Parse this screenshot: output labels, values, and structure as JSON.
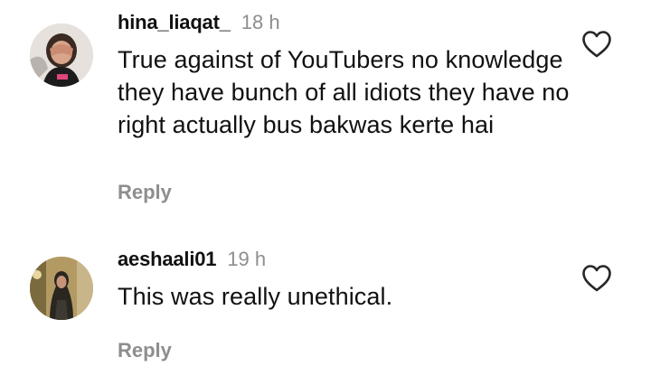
{
  "comments": [
    {
      "username": "hina_liaqat_",
      "time": "18 h",
      "text": "True against of YouTubers no knowledge they have bunch of all idiots they have no right actually bus bakwas kerte hai",
      "reply_label": "Reply",
      "avatar_icon": "avatar-photo",
      "like_icon": "heart-outline-icon"
    },
    {
      "username": "aeshaali01",
      "time": "19 h",
      "text": "This was really unethical.",
      "reply_label": "Reply",
      "avatar_icon": "avatar-photo",
      "like_icon": "heart-outline-icon"
    }
  ],
  "colors": {
    "text": "#111111",
    "muted": "#8e8e8e",
    "background": "#ffffff"
  }
}
